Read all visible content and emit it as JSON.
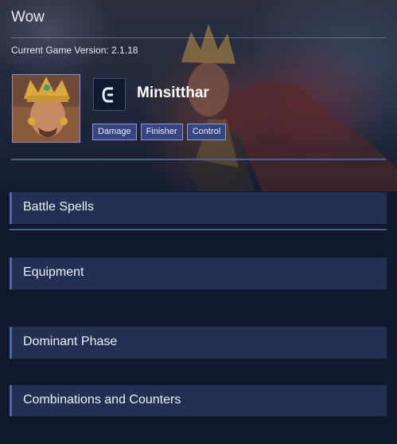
{
  "header": {
    "title": "Wow",
    "version_label": "Current Game Version: 2.1.18"
  },
  "hero": {
    "name": "Minsitthar",
    "role_icon": "role-emblem-icon",
    "tags": [
      "Damage",
      "Finisher",
      "Control"
    ]
  },
  "sections": [
    {
      "label": "Battle Spells"
    },
    {
      "label": "Equipment"
    },
    {
      "label": "Dominant Phase"
    },
    {
      "label": "Combinations and Counters"
    }
  ],
  "colors": {
    "background": "#111a2c",
    "section_bg": "#223151",
    "section_accent": "#5468a0",
    "tag_bg": "#374682",
    "tag_border": "#8d9ad6"
  }
}
